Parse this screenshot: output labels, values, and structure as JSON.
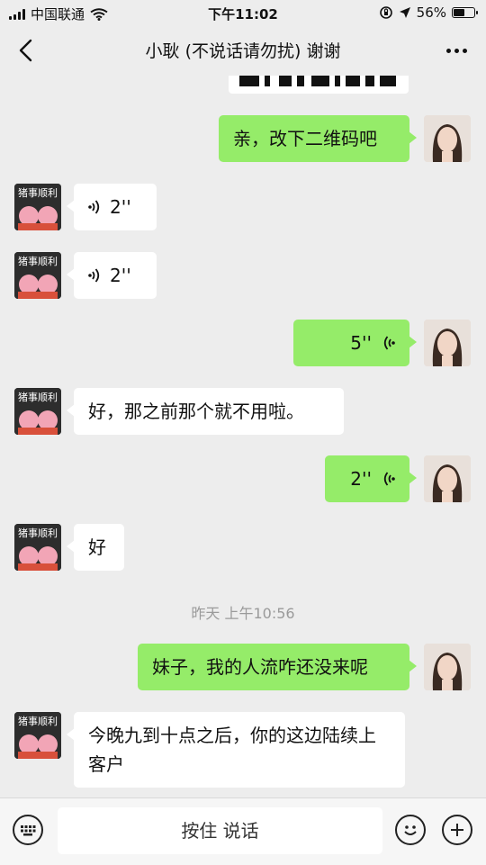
{
  "status": {
    "carrier": "中国联通",
    "time": "下午11:02",
    "battery": "56%",
    "battery_level": 0.56
  },
  "header": {
    "title": "小耿 (不说话请勿扰) 谢谢"
  },
  "messages": [
    {
      "from": "me",
      "type": "text",
      "text": "亲，改下二维码吧"
    },
    {
      "from": "other",
      "type": "voice",
      "duration": "2''"
    },
    {
      "from": "other",
      "type": "voice",
      "duration": "2''"
    },
    {
      "from": "me",
      "type": "voice",
      "duration": "5''"
    },
    {
      "from": "other",
      "type": "text",
      "text": "好，那之前那个就不用啦。"
    },
    {
      "from": "me",
      "type": "voice",
      "duration": "2''"
    },
    {
      "from": "other",
      "type": "text",
      "text": "好"
    },
    {
      "type": "timestamp",
      "text": "昨天 上午10:56"
    },
    {
      "from": "me",
      "type": "text",
      "text": "妹子，我的人流咋还没来呢"
    },
    {
      "from": "other",
      "type": "text",
      "text": "今晚九到十点之后，你的这边陆续上客户"
    }
  ],
  "input": {
    "hold_to_talk": "按住 说话"
  },
  "icons": {
    "back": "back-chevron-icon",
    "more": "more-dots-icon",
    "keyboard": "keyboard-icon",
    "emoji": "emoji-icon",
    "add": "plus-icon",
    "voice": "voice-wave-icon",
    "wifi": "wifi-icon",
    "location": "location-arrow-icon",
    "lock": "orientation-lock-icon"
  },
  "avatars": {
    "other_badge": "猪事顺利"
  },
  "colors": {
    "out_bubble": "#95ec69",
    "in_bubble": "#ffffff",
    "background": "#ededed"
  }
}
